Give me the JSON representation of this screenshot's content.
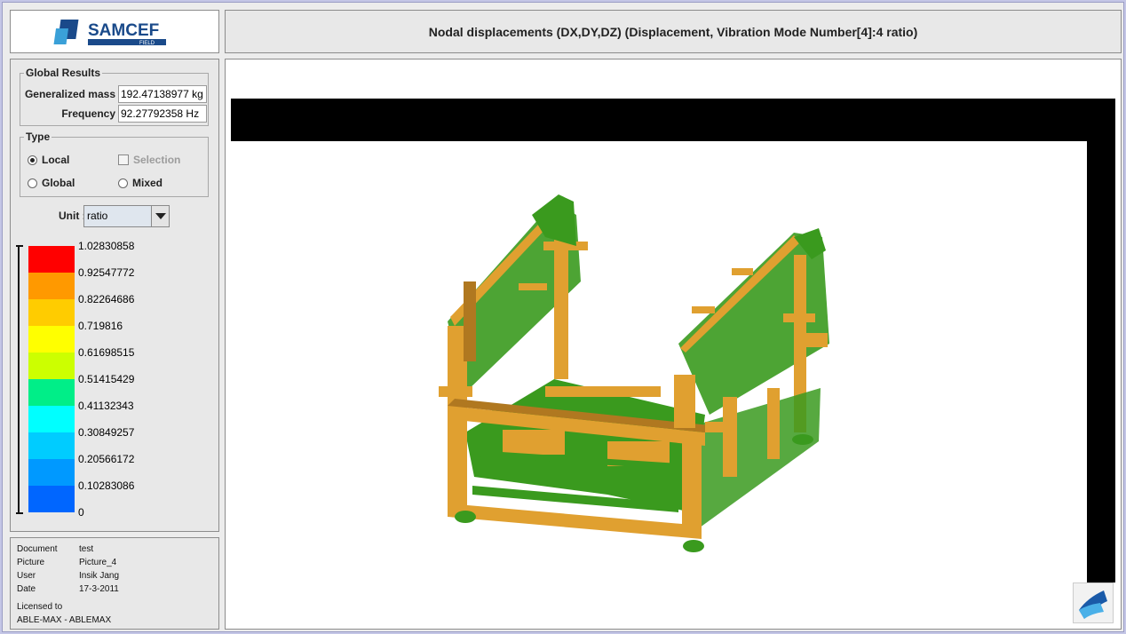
{
  "brand": {
    "name": "SAMCEF",
    "sub": "FIELD"
  },
  "header": {
    "title": "Nodal displacements (DX,DY,DZ) (Displacement, Vibration Mode Number[4]:4 ratio)"
  },
  "global_results": {
    "legend": "Global Results",
    "generalized_mass_label": "Generalized mass",
    "generalized_mass_value": "192.47138977 kg",
    "frequency_label": "Frequency",
    "frequency_value": "92.27792358 Hz"
  },
  "type": {
    "legend": "Type",
    "options": [
      {
        "label": "Local",
        "selected": true
      },
      {
        "label": "Selection",
        "disabled": true
      },
      {
        "label": "Global",
        "selected": false
      },
      {
        "label": "Mixed",
        "selected": false
      }
    ]
  },
  "unit": {
    "label": "Unit :",
    "value": "ratio"
  },
  "scale": {
    "ticks": [
      "1.02830858",
      "0.92547772",
      "0.82264686",
      "0.719816",
      "0.61698515",
      "0.51415429",
      "0.41132343",
      "0.30849257",
      "0.20566172",
      "0.10283086",
      "0"
    ],
    "colors": [
      "#ff0000",
      "#ff9900",
      "#ffcc00",
      "#ffff00",
      "#ccff00",
      "#00ee88",
      "#00ffff",
      "#00ccff",
      "#0099ff",
      "#0066ff"
    ]
  },
  "document_info": {
    "document_label": "Document",
    "document_value": "test",
    "picture_label": "Picture",
    "picture_value": "Picture_4",
    "user_label": "User",
    "user_value": "Insik Jang",
    "date_label": "Date",
    "date_value": "17-3-2011",
    "licensed_label": "Licensed to",
    "licensed_value": "ABLE-MAX - ABLEMAX"
  },
  "colors": {
    "structure": "#e0a030",
    "structure_dark": "#b07820",
    "displacement": "#3a9a1e"
  }
}
